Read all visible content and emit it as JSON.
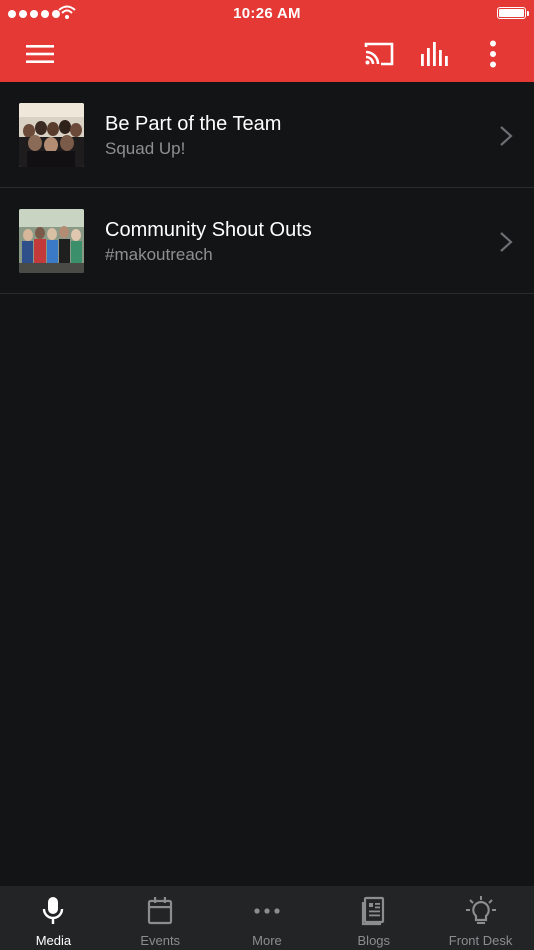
{
  "status_bar": {
    "time": "10:26 AM"
  },
  "colors": {
    "header": "#e53935",
    "background": "#131415",
    "tab_active": "#ffffff",
    "tab_inactive": "#8c8d8f"
  },
  "toolbar": {
    "menu_icon": "hamburger-menu-icon",
    "cast_icon": "cast-icon",
    "equalizer_icon": "equalizer-icon",
    "overflow_icon": "more-vertical-icon"
  },
  "list": [
    {
      "title": "Be Part of the Team",
      "subtitle": "Squad Up!",
      "thumbnail": "team-photo"
    },
    {
      "title": "Community Shout Outs",
      "subtitle": "#makoutreach",
      "thumbnail": "community-photo"
    }
  ],
  "tabs": [
    {
      "label": "Media",
      "icon": "microphone-icon",
      "active": true
    },
    {
      "label": "Events",
      "icon": "calendar-icon",
      "active": false
    },
    {
      "label": "More",
      "icon": "more-horizontal-icon",
      "active": false
    },
    {
      "label": "Blogs",
      "icon": "newspaper-icon",
      "active": false
    },
    {
      "label": "Front Desk",
      "icon": "lightbulb-icon",
      "active": false
    }
  ]
}
